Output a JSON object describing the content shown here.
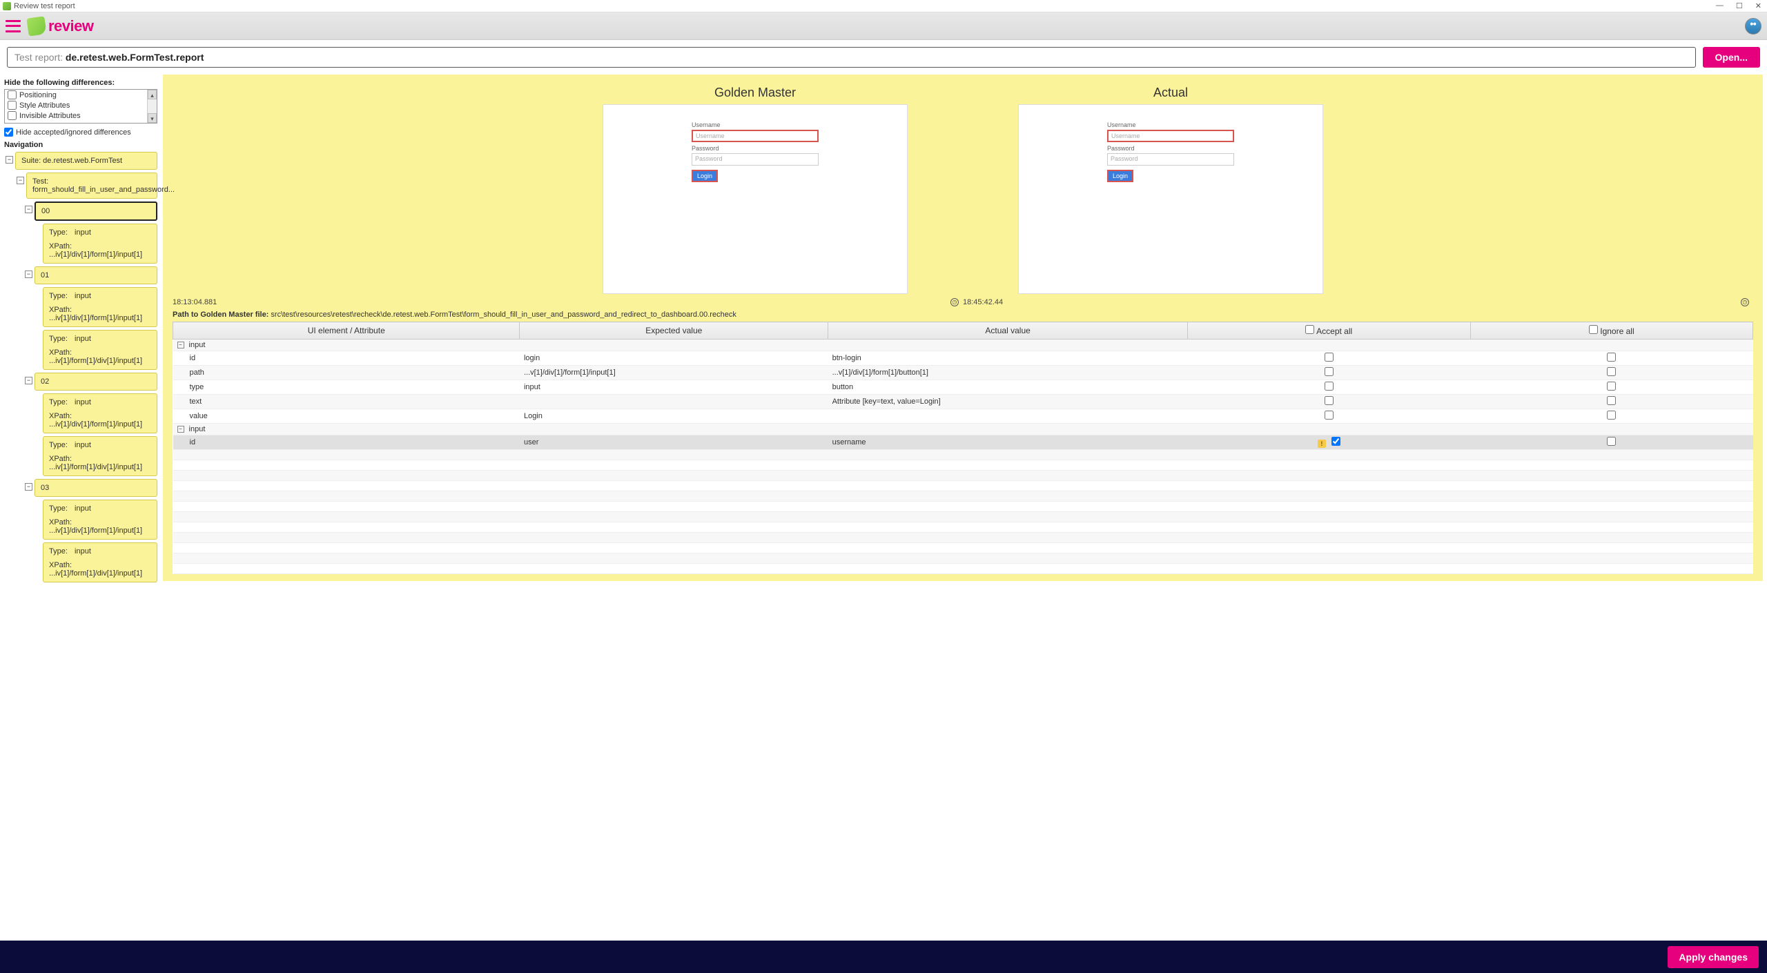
{
  "window": {
    "title": "Review test report"
  },
  "brand": {
    "text": "review"
  },
  "report_bar": {
    "label": "Test report: ",
    "value": "de.retest.web.FormTest.report",
    "open_label": "Open..."
  },
  "filters": {
    "heading": "Hide the following differences:",
    "options": [
      "Positioning",
      "Style Attributes",
      "Invisible Attributes"
    ],
    "hide_accepted_label": "Hide accepted/ignored differences",
    "hide_accepted_checked": true
  },
  "nav": {
    "heading": "Navigation",
    "suite": "Suite: de.retest.web.FormTest",
    "test": "Test: form_should_fill_in_user_and_password...",
    "steps": [
      {
        "label": "00",
        "selected": true,
        "items": [
          {
            "type": "input",
            "xpath": "...iv[1]/div[1]/form[1]/input[1]"
          }
        ]
      },
      {
        "label": "01",
        "items": [
          {
            "type": "input",
            "xpath": "...iv[1]/div[1]/form[1]/input[1]"
          },
          {
            "type": "input",
            "xpath": "...iv[1]/form[1]/div[1]/input[1]"
          }
        ]
      },
      {
        "label": "02",
        "items": [
          {
            "type": "input",
            "xpath": "...iv[1]/div[1]/form[1]/input[1]"
          },
          {
            "type": "input",
            "xpath": "...iv[1]/form[1]/div[1]/input[1]"
          }
        ]
      },
      {
        "label": "03",
        "items": [
          {
            "type": "input",
            "xpath": "...iv[1]/div[1]/form[1]/input[1]"
          },
          {
            "type": "input",
            "xpath": "...iv[1]/form[1]/div[1]/input[1]"
          }
        ]
      }
    ]
  },
  "preview": {
    "golden_label": "Golden Master",
    "actual_label": "Actual",
    "form": {
      "username_label": "Username",
      "username_ph": "Username",
      "password_label": "Password",
      "password_ph": "Password",
      "login_label": "Login"
    },
    "time_golden": "18:13:04.881",
    "time_actual": "18:45:42.44"
  },
  "gm_path": {
    "label": "Path to Golden Master file: ",
    "value": "src\\test\\resources\\retest\\recheck\\de.retest.web.FormTest\\form_should_fill_in_user_and_password_and_redirect_to_dashboard.00.recheck"
  },
  "diff": {
    "headers": {
      "ui": "UI element / Attribute",
      "expected": "Expected value",
      "actual": "Actual value",
      "accept": "Accept all",
      "ignore": "Ignore all"
    },
    "rows": [
      {
        "kind": "group",
        "label": "input"
      },
      {
        "kind": "attr",
        "name": "id",
        "expected": "login",
        "actual": "btn-login",
        "accept": false,
        "ignore": false
      },
      {
        "kind": "attr",
        "name": "path",
        "expected": "...v[1]/div[1]/form[1]/input[1]",
        "actual": "...v[1]/div[1]/form[1]/button[1]",
        "accept": false,
        "ignore": false
      },
      {
        "kind": "attr",
        "name": "type",
        "expected": "input",
        "actual": "button",
        "accept": false,
        "ignore": false
      },
      {
        "kind": "attr",
        "name": "text",
        "expected": "",
        "actual": "Attribute [key=text, value=Login]",
        "accept": false,
        "ignore": false
      },
      {
        "kind": "attr",
        "name": "value",
        "expected": "Login",
        "actual": "",
        "accept": false,
        "ignore": false
      },
      {
        "kind": "group",
        "label": "input"
      },
      {
        "kind": "attr",
        "name": "id",
        "expected": "user",
        "actual": "username",
        "warn": true,
        "accept": true,
        "ignore": false,
        "selected": true
      }
    ]
  },
  "footer": {
    "apply_label": "Apply changes"
  },
  "labels": {
    "type": "Type:",
    "xpath": "XPath:"
  }
}
